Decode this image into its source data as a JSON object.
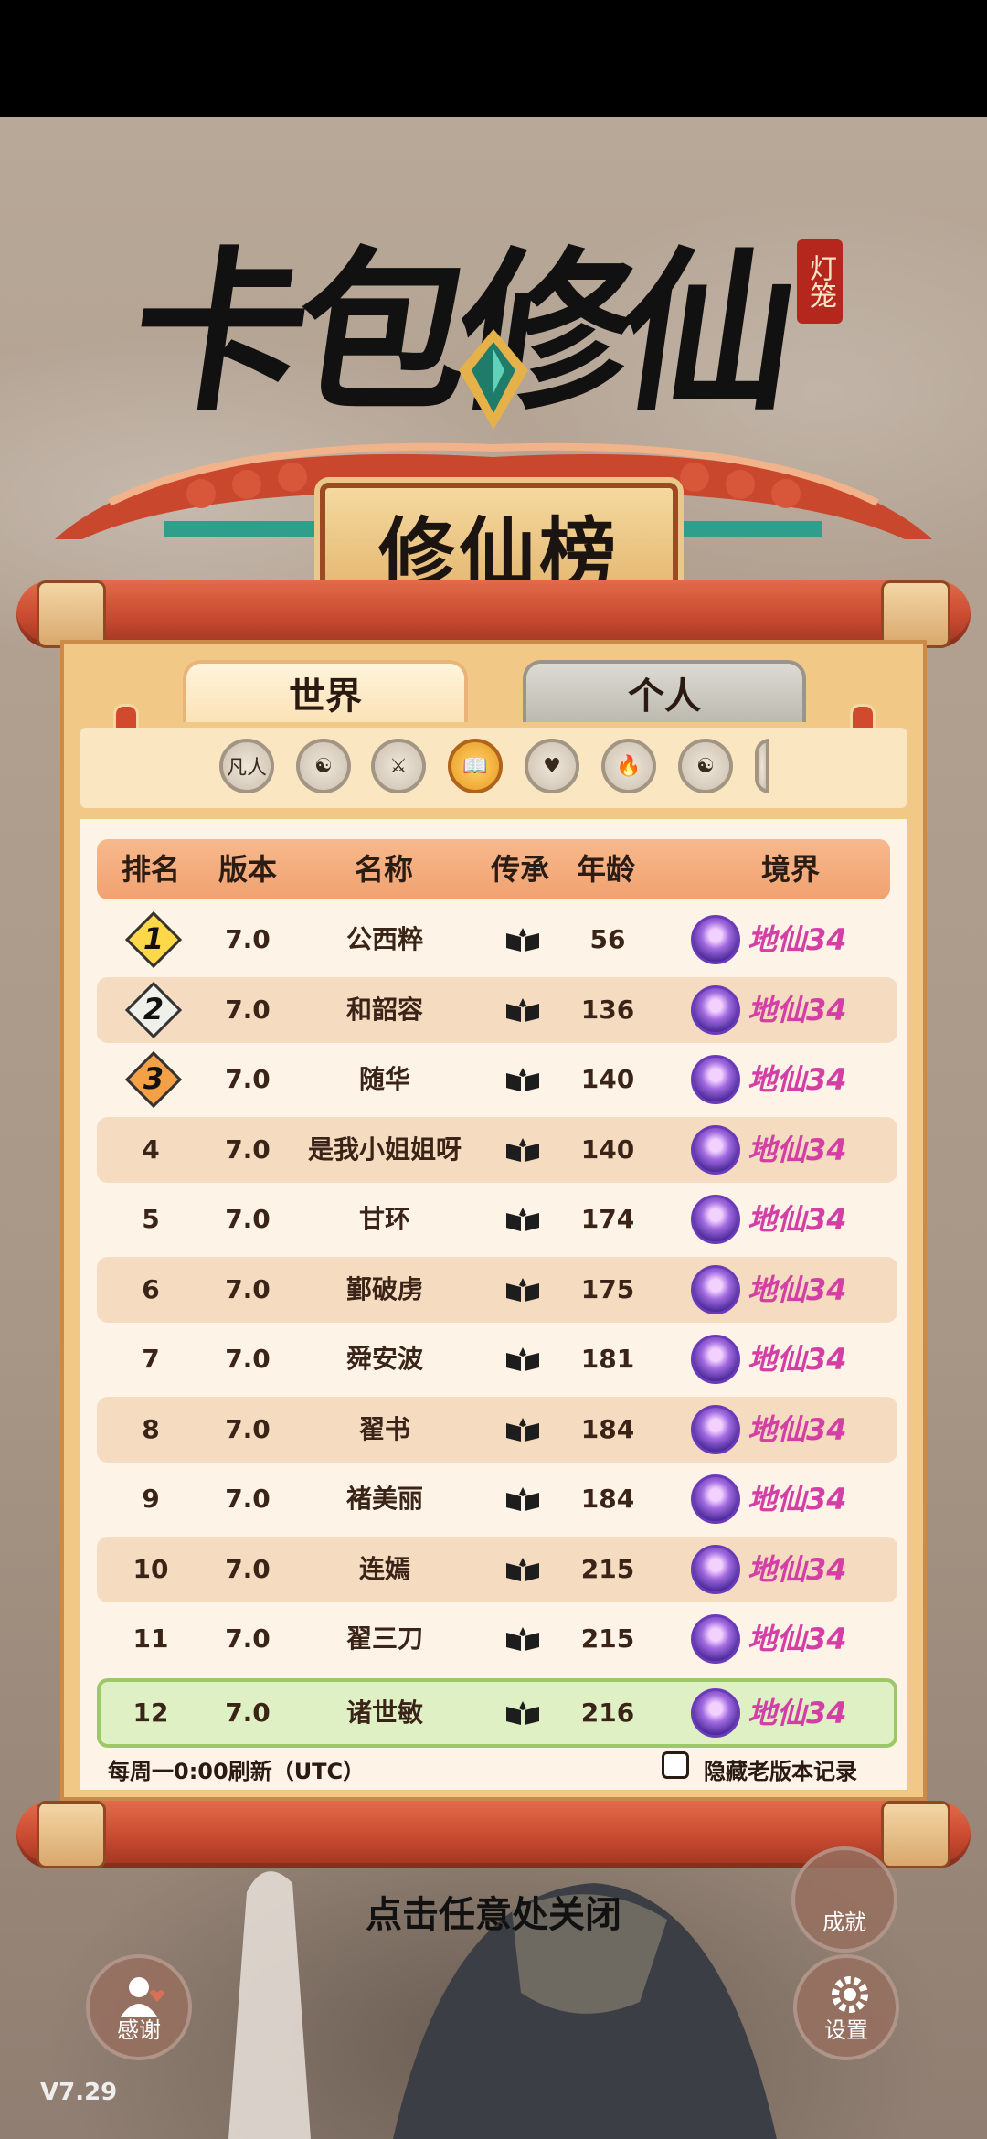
{
  "title": "卡包修仙",
  "seal_text": "灯笼",
  "banner_title": "修仙榜",
  "tabs": {
    "world": "世界",
    "personal": "个人"
  },
  "filters": [
    {
      "name": "mortal-filter",
      "label": "凡人",
      "icon": "text"
    },
    {
      "name": "yin-yang-filter",
      "label": "",
      "icon": "yin-yang"
    },
    {
      "name": "sword-filter",
      "label": "",
      "icon": "sword"
    },
    {
      "name": "book-filter",
      "label": "",
      "icon": "book",
      "active": true
    },
    {
      "name": "heart-filter",
      "label": "",
      "icon": "heart"
    },
    {
      "name": "fire-filter",
      "label": "",
      "icon": "fire"
    },
    {
      "name": "taiji-filter",
      "label": "",
      "icon": "taiji"
    }
  ],
  "table": {
    "headers": {
      "rank": "排名",
      "version": "版本",
      "name": "名称",
      "lineage": "传承",
      "age": "年龄",
      "realm": "境界"
    },
    "rows": [
      {
        "rank": "1",
        "version": "7.0",
        "name": "公西粹",
        "age": "56",
        "realm": "地仙34",
        "badge": "gold"
      },
      {
        "rank": "2",
        "version": "7.0",
        "name": "和韶容",
        "age": "136",
        "realm": "地仙34",
        "badge": "silver"
      },
      {
        "rank": "3",
        "version": "7.0",
        "name": "随华",
        "age": "140",
        "realm": "地仙34",
        "badge": "bronze"
      },
      {
        "rank": "4",
        "version": "7.0",
        "name": "是我小姐姐呀",
        "age": "140",
        "realm": "地仙34"
      },
      {
        "rank": "5",
        "version": "7.0",
        "name": "甘环",
        "age": "174",
        "realm": "地仙34"
      },
      {
        "rank": "6",
        "version": "7.0",
        "name": "鄞破虏",
        "age": "175",
        "realm": "地仙34"
      },
      {
        "rank": "7",
        "version": "7.0",
        "name": "舜安波",
        "age": "181",
        "realm": "地仙34"
      },
      {
        "rank": "8",
        "version": "7.0",
        "name": "翟书",
        "age": "184",
        "realm": "地仙34"
      },
      {
        "rank": "9",
        "version": "7.0",
        "name": "褚美丽",
        "age": "184",
        "realm": "地仙34"
      },
      {
        "rank": "10",
        "version": "7.0",
        "name": "连嫣",
        "age": "215",
        "realm": "地仙34"
      },
      {
        "rank": "11",
        "version": "7.0",
        "name": "翟三刀",
        "age": "215",
        "realm": "地仙34"
      },
      {
        "rank": "12",
        "version": "7.0",
        "name": "诸世敏",
        "age": "216",
        "realm": "地仙34",
        "mine": true
      }
    ]
  },
  "footer": {
    "refresh_note": "每周一0:00刷新（UTC）",
    "hide_old_label": "隐藏老版本记录"
  },
  "close_hint": "点击任意处关闭",
  "buttons": {
    "thanks": "感谢",
    "achievements": "成就",
    "settings": "设置"
  },
  "version": "V7.29",
  "colors": {
    "realm_text": "#d43fa6",
    "mine_row": "#dff0c4",
    "header": "#f1a170"
  }
}
